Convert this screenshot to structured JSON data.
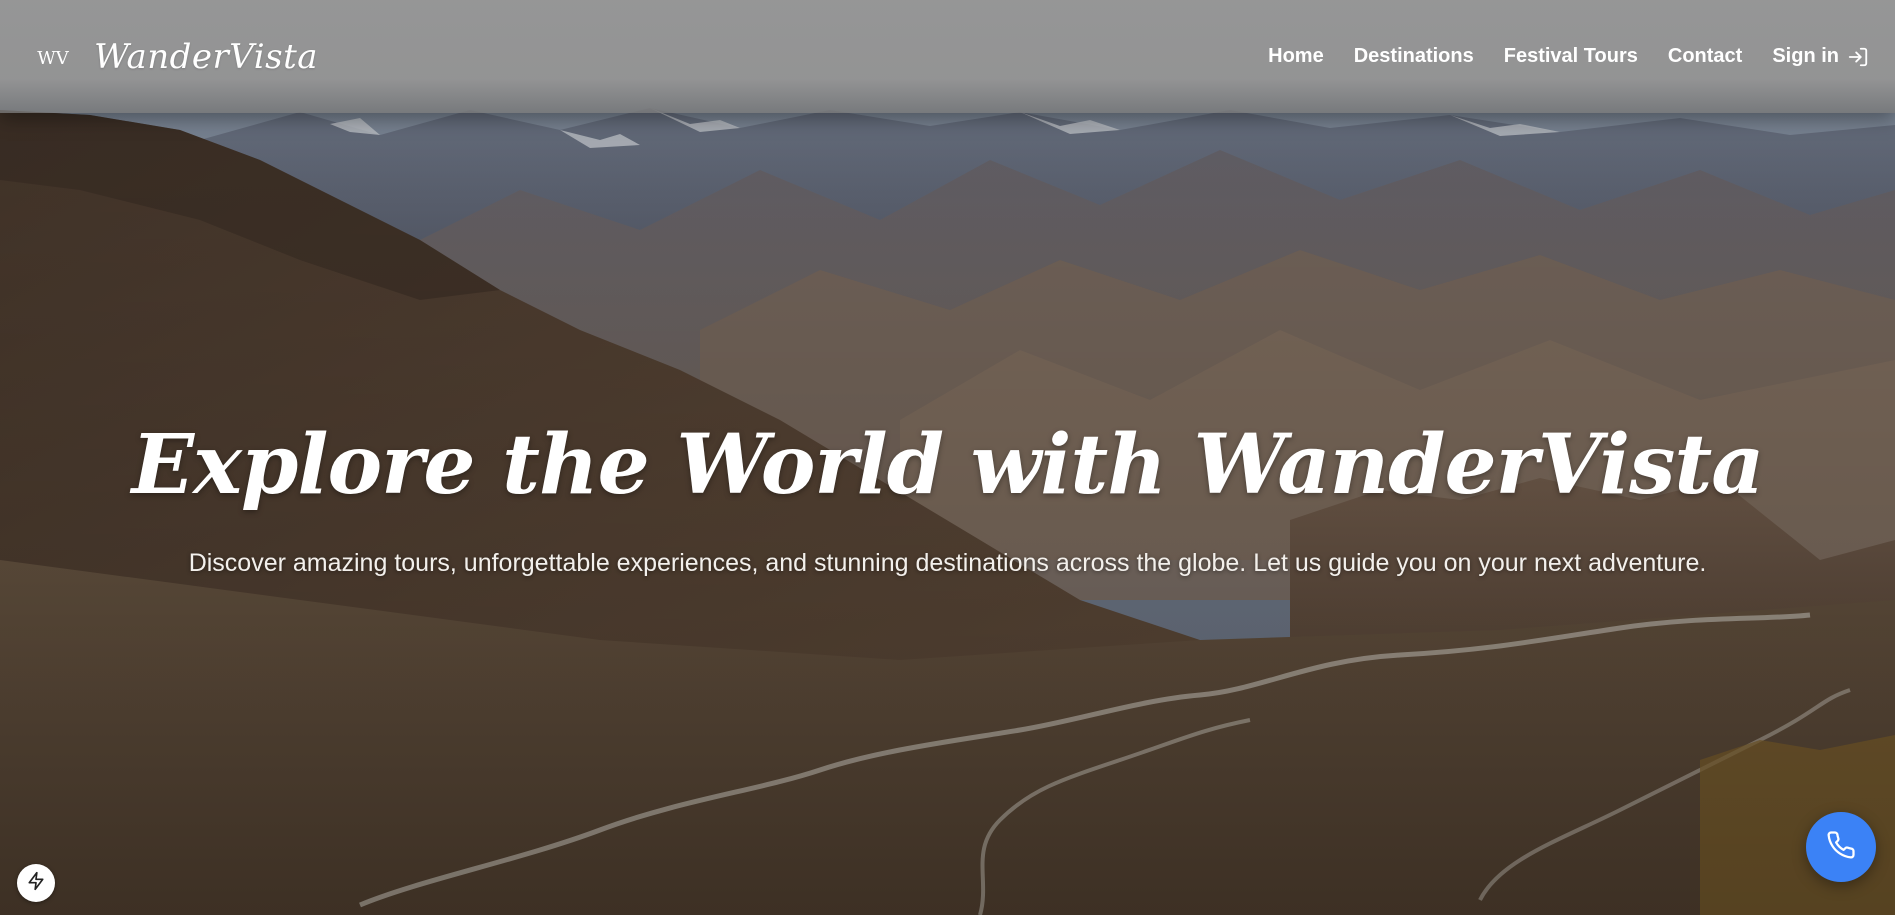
{
  "navbar": {
    "brand_name": "WanderVista",
    "logo_text": "WV",
    "links": [
      {
        "label": "Home"
      },
      {
        "label": "Destinations"
      },
      {
        "label": "Festival Tours"
      },
      {
        "label": "Contact"
      },
      {
        "label": "Sign in"
      }
    ],
    "signin_icon": "sign-in-arrow-icon"
  },
  "hero": {
    "title": "Explore the World with WanderVista",
    "subtitle": "Discover amazing tours, unforgettable experiences, and stunning destinations across the globe. Let us guide you on your next adventure.",
    "background": "mountain-landscape"
  },
  "floating": {
    "call_icon": "phone-icon",
    "call_color": "#3b82f6",
    "dev_icon": "lightning-bolt-icon"
  }
}
